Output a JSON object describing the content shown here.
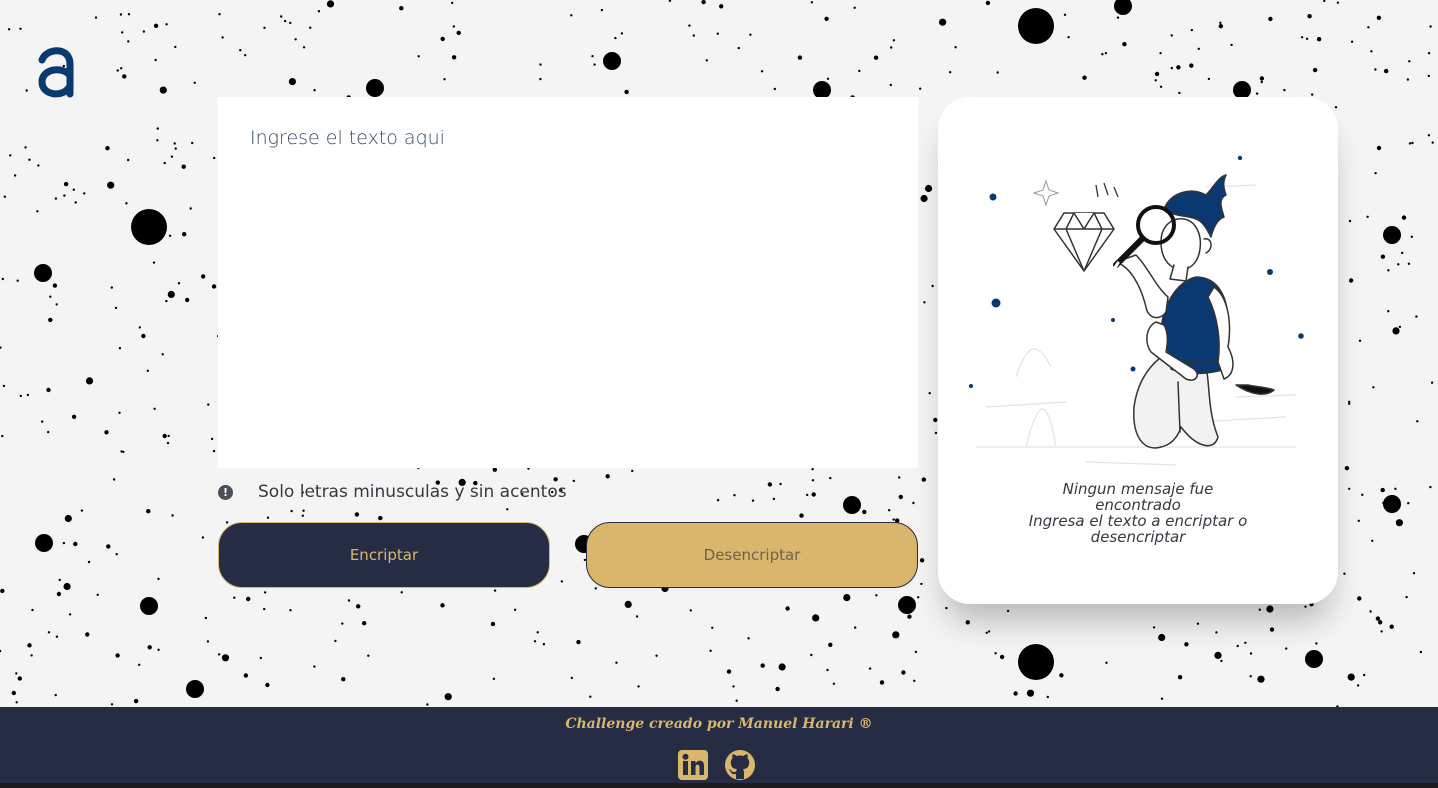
{
  "colors": {
    "background": "#f4f4f4",
    "dark_blue": "#0a3871",
    "navy": "#252c43",
    "gold": "#d9b66b"
  },
  "header": {
    "logo_icon": "alura-a-logo-icon"
  },
  "input": {
    "placeholder": "Ingrese el texto aqui",
    "value": ""
  },
  "hint": {
    "icon": "exclamation-circle-icon",
    "text": "Solo letras minusculas y sin acentos"
  },
  "buttons": {
    "encrypt_label": "Encriptar",
    "decrypt_label": "Desencriptar"
  },
  "result": {
    "illustration": "person-with-magnifying-glass-illustration",
    "title": "Ningun mensaje fue encontrado",
    "subtitle": "Ingresa el texto a encriptar o desencriptar"
  },
  "footer": {
    "credit": "Challenge creado por Manuel Harari ®",
    "social": [
      "linkedin-icon",
      "github-icon"
    ]
  }
}
